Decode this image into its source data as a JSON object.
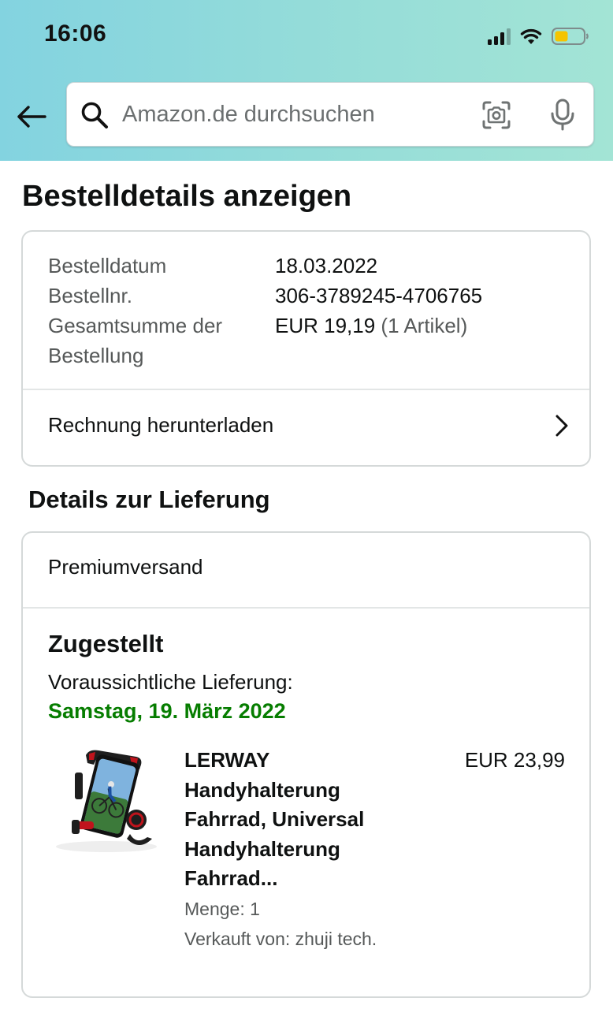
{
  "status_bar": {
    "time": "16:06",
    "battery_color": "#f5c400"
  },
  "search": {
    "placeholder": "Amazon.de durchsuchen"
  },
  "page_title": "Bestelldetails anzeigen",
  "order_summary": {
    "rows": [
      {
        "label": "Bestelldatum",
        "value": "18.03.2022"
      },
      {
        "label": "Bestellnr.",
        "value": "306-3789245-4706765"
      }
    ],
    "total": {
      "label": "Gesamtsumme der Bestellung",
      "amount": "EUR 19,19",
      "items_count": "(1 Artikel)"
    },
    "invoice_link": "Rechnung herunterladen"
  },
  "delivery": {
    "section_title": "Details zur Lieferung",
    "shipping_type": "Premiumversand",
    "status": "Zugestellt",
    "eta_label": "Voraussichtliche Lieferung:",
    "eta_date": "Samstag, 19. März 2022",
    "eta_color": "#067d00",
    "product": {
      "title": "LERWAY Handyhalterung Fahrrad, Universal Handyhalterung Fahrrad...",
      "price": "EUR 23,99",
      "quantity": "Menge: 1",
      "seller": "Verkauft von: zhuji tech."
    }
  }
}
